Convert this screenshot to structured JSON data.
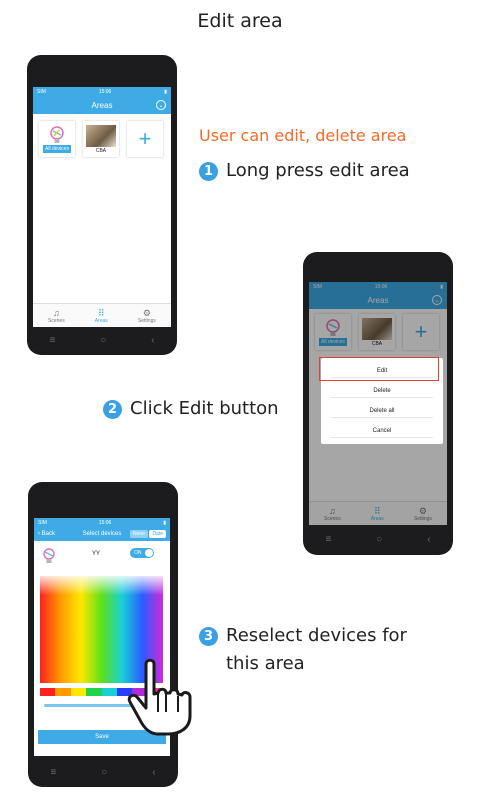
{
  "title": "Edit area",
  "note": "User can edit, delete area",
  "steps": [
    {
      "num": "1",
      "text": "Long press edit area"
    },
    {
      "num": "2",
      "text": "Click Edit button"
    },
    {
      "num": "3",
      "text": "Reselect devices for this area"
    }
  ],
  "status": {
    "carrier": "SIM",
    "time": "15:06"
  },
  "areas_screen": {
    "title": "Areas",
    "cards": [
      {
        "label": "All devices"
      },
      {
        "label": "CBA"
      }
    ],
    "add_symbol": "+"
  },
  "tabs": [
    {
      "label": "Scenes",
      "icon": "scenes-icon"
    },
    {
      "label": "Areas",
      "icon": "grid-icon"
    },
    {
      "label": "Settings",
      "icon": "gear-icon"
    }
  ],
  "dialog": {
    "edit": "Edit",
    "delete": "Delete",
    "delete_all": "Delete all",
    "cancel": "Cancel"
  },
  "select_screen": {
    "back": "Back",
    "title": "Select devices",
    "none": "None",
    "date": "Date",
    "device_name": "YY",
    "toggle": "ON",
    "save": "Save"
  },
  "colors": {
    "accent": "#3eabe7",
    "highlight": "#e0442a",
    "note": "#f36b2b"
  }
}
